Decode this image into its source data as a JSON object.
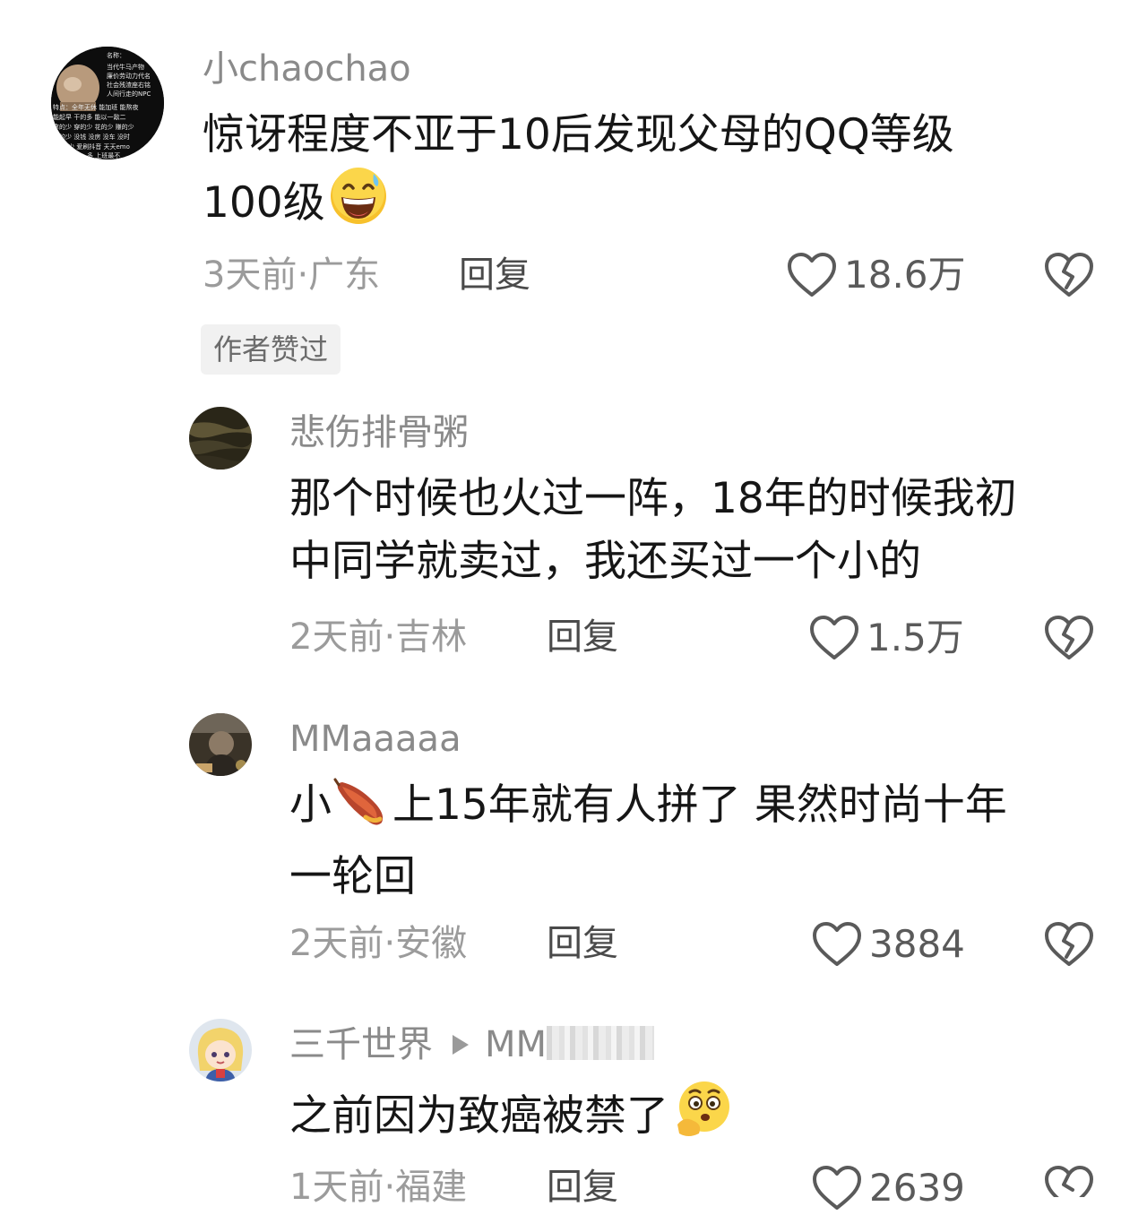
{
  "comments": [
    {
      "username": "小chaochao",
      "lines": [
        "惊讶程度不亚于10后发现父母的QQ等级",
        "100级"
      ],
      "time_location": "3天前·广东",
      "reply_label": "回复",
      "likes": "18.6万",
      "badge": "作者赞过",
      "avatar_text": [
        "名称：",
        "当代牛马产物",
        "廉价劳动力代名",
        "社会残渣座右铭",
        "人间行走的NPC",
        "特点：全年无休 能加班 能熬夜",
        "能起早 干的多 能以一敌二",
        "拿的少 穿的少 花的少 赚的少",
        "吃的少 没钱 没房 没车 没时",
        "间少 爱刷抖音 天天emo",
        "多 上班最不"
      ],
      "emoji": "grinning-sweat-emoji"
    },
    {
      "username": "悲伤排骨粥",
      "lines": [
        "那个时候也火过一阵，18年的时候我初",
        "中同学就卖过，我还买过一个小的"
      ],
      "time_location": "2天前·吉林",
      "reply_label": "回复",
      "likes": "1.5万"
    },
    {
      "username": "MMaaaaa",
      "lines_parts": [
        [
          "小",
          "上15年就有人拼了 果然时尚十年"
        ],
        [
          "一轮回"
        ]
      ],
      "time_location": "2天前·安徽",
      "reply_label": "回复",
      "likes": "3884",
      "emoji": "sweet-potato-emoji"
    },
    {
      "username": "三千世界",
      "reply_to": "MM",
      "lines": [
        "之前因为致癌被禁了"
      ],
      "time_location": "1天前·福建",
      "reply_label": "回复",
      "likes": "2639",
      "emoji": "thinking-face-emoji"
    }
  ],
  "colors": {
    "text": "#161616",
    "muted": "#9b9b9b",
    "username": "#8a8a8a",
    "badge_bg": "#f1f1f1"
  }
}
